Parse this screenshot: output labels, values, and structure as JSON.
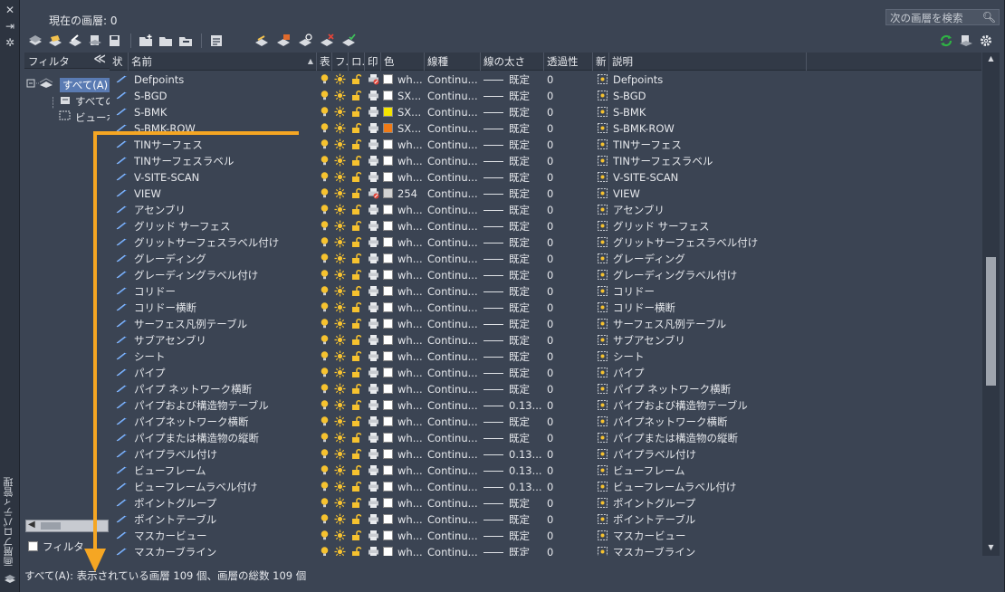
{
  "side_panel": {
    "title": "画層プロパティ管理",
    "buttons": [
      "close-icon",
      "pin-icon",
      "settings-icon"
    ]
  },
  "header": {
    "current_layer_label": "現在の画層: 0",
    "search_placeholder": "次の画層を検索"
  },
  "filter_pane": {
    "header_label": "フィルタ",
    "collapse_glyph": "≪",
    "tree": [
      {
        "label": "すべて(A)",
        "selected": true
      },
      {
        "label": "すべての使用画層",
        "selected": false
      },
      {
        "label": "ビューポート優先",
        "selected": false
      }
    ],
    "invert_filter_label": "フィルタ"
  },
  "columns": {
    "status": "状",
    "name": "名前",
    "on": "表",
    "freeze": "フ.",
    "lock": "ロ.",
    "plot": "印",
    "color": "色",
    "linetype": "線種",
    "lineweight": "線の太さ",
    "transparency": "透過性",
    "new_vp_freeze": "新",
    "description": "説明"
  },
  "rows": [
    {
      "name": "Defpoints",
      "color": "wh...",
      "swatch": "#ffffff",
      "linetype": "Continu...",
      "lineweight": "既定",
      "transparency": "0",
      "description": "Defpoints",
      "plot": "noplot"
    },
    {
      "name": "S-BGD",
      "color": "SX...",
      "swatch": "#ffffff",
      "linetype": "Continu...",
      "lineweight": "既定",
      "transparency": "0",
      "description": "S-BGD",
      "plot": "plot"
    },
    {
      "name": "S-BMK",
      "color": "SX...",
      "swatch": "#f5e400",
      "linetype": "Continu...",
      "lineweight": "既定",
      "transparency": "0",
      "description": "S-BMK",
      "plot": "plot"
    },
    {
      "name": "S-BMK-ROW",
      "color": "SX...",
      "swatch": "#f07a16",
      "linetype": "Continu...",
      "lineweight": "既定",
      "transparency": "0",
      "description": "S-BMK-ROW",
      "plot": "plot"
    },
    {
      "name": "TINサーフェス",
      "color": "wh...",
      "swatch": "#ffffff",
      "linetype": "Continu...",
      "lineweight": "既定",
      "transparency": "0",
      "description": "TINサーフェス",
      "plot": "plot"
    },
    {
      "name": "TINサーフェスラベル",
      "color": "wh...",
      "swatch": "#ffffff",
      "linetype": "Continu...",
      "lineweight": "既定",
      "transparency": "0",
      "description": "TINサーフェスラベル",
      "plot": "plot"
    },
    {
      "name": "V-SITE-SCAN",
      "color": "wh...",
      "swatch": "#ffffff",
      "linetype": "Continu...",
      "lineweight": "既定",
      "transparency": "0",
      "description": "V-SITE-SCAN",
      "plot": "plot"
    },
    {
      "name": "VIEW",
      "color": "254",
      "swatch": "#d2d2d2",
      "linetype": "Continu...",
      "lineweight": "既定",
      "transparency": "0",
      "description": "VIEW",
      "plot": "noplot"
    },
    {
      "name": "アセンブリ",
      "color": "wh...",
      "swatch": "#ffffff",
      "linetype": "Continu...",
      "lineweight": "既定",
      "transparency": "0",
      "description": "アセンブリ",
      "plot": "plot"
    },
    {
      "name": "グリッド サーフェス",
      "color": "wh...",
      "swatch": "#ffffff",
      "linetype": "Continu...",
      "lineweight": "既定",
      "transparency": "0",
      "description": "グリッド サーフェス",
      "plot": "plot"
    },
    {
      "name": "グリットサーフェスラベル付け",
      "color": "wh...",
      "swatch": "#ffffff",
      "linetype": "Continu...",
      "lineweight": "既定",
      "transparency": "0",
      "description": "グリットサーフェスラベル付け",
      "plot": "plot"
    },
    {
      "name": "グレーディング",
      "color": "wh...",
      "swatch": "#ffffff",
      "linetype": "Continu...",
      "lineweight": "既定",
      "transparency": "0",
      "description": "グレーディング",
      "plot": "plot"
    },
    {
      "name": "グレーディングラベル付け",
      "color": "wh...",
      "swatch": "#ffffff",
      "linetype": "Continu...",
      "lineweight": "既定",
      "transparency": "0",
      "description": "グレーディングラベル付け",
      "plot": "plot"
    },
    {
      "name": "コリドー",
      "color": "wh...",
      "swatch": "#ffffff",
      "linetype": "Continu...",
      "lineweight": "既定",
      "transparency": "0",
      "description": "コリドー",
      "plot": "plot"
    },
    {
      "name": "コリドー横断",
      "color": "wh...",
      "swatch": "#ffffff",
      "linetype": "Continu...",
      "lineweight": "既定",
      "transparency": "0",
      "description": "コリドー横断",
      "plot": "plot"
    },
    {
      "name": "サーフェス凡例テーブル",
      "color": "wh...",
      "swatch": "#ffffff",
      "linetype": "Continu...",
      "lineweight": "既定",
      "transparency": "0",
      "description": "サーフェス凡例テーブル",
      "plot": "plot"
    },
    {
      "name": "サブアセンブリ",
      "color": "wh...",
      "swatch": "#ffffff",
      "linetype": "Continu...",
      "lineweight": "既定",
      "transparency": "0",
      "description": "サブアセンブリ",
      "plot": "plot"
    },
    {
      "name": "シート",
      "color": "wh...",
      "swatch": "#ffffff",
      "linetype": "Continu...",
      "lineweight": "既定",
      "transparency": "0",
      "description": "シート",
      "plot": "plot"
    },
    {
      "name": "パイプ",
      "color": "wh...",
      "swatch": "#ffffff",
      "linetype": "Continu...",
      "lineweight": "既定",
      "transparency": "0",
      "description": "パイプ",
      "plot": "plot"
    },
    {
      "name": "パイプ ネットワーク横断",
      "color": "wh...",
      "swatch": "#ffffff",
      "linetype": "Continu...",
      "lineweight": "既定",
      "transparency": "0",
      "description": "パイプ ネットワーク横断",
      "plot": "plot"
    },
    {
      "name": "パイプおよび構造物テーブル",
      "color": "wh...",
      "swatch": "#ffffff",
      "linetype": "Continu...",
      "lineweight": "0.13...",
      "transparency": "0",
      "description": "パイプおよび構造物テーブル",
      "plot": "plot"
    },
    {
      "name": "パイプネットワーク横断",
      "color": "wh...",
      "swatch": "#ffffff",
      "linetype": "Continu...",
      "lineweight": "既定",
      "transparency": "0",
      "description": "パイプネットワーク横断",
      "plot": "plot"
    },
    {
      "name": "パイプまたは構造物の縦断",
      "color": "wh...",
      "swatch": "#ffffff",
      "linetype": "Continu...",
      "lineweight": "既定",
      "transparency": "0",
      "description": "パイプまたは構造物の縦断",
      "plot": "plot"
    },
    {
      "name": "パイプラベル付け",
      "color": "wh...",
      "swatch": "#ffffff",
      "linetype": "Continu...",
      "lineweight": "0.13...",
      "transparency": "0",
      "description": "パイプラベル付け",
      "plot": "plot"
    },
    {
      "name": "ビューフレーム",
      "color": "wh...",
      "swatch": "#ffffff",
      "linetype": "Continu...",
      "lineweight": "0.13...",
      "transparency": "0",
      "description": "ビューフレーム",
      "plot": "plot"
    },
    {
      "name": "ビューフレームラベル付け",
      "color": "wh...",
      "swatch": "#ffffff",
      "linetype": "Continu...",
      "lineweight": "0.13...",
      "transparency": "0",
      "description": "ビューフレームラベル付け",
      "plot": "plot"
    },
    {
      "name": "ポイントグループ",
      "color": "wh...",
      "swatch": "#ffffff",
      "linetype": "Continu...",
      "lineweight": "既定",
      "transparency": "0",
      "description": "ポイントグループ",
      "plot": "plot"
    },
    {
      "name": "ポイントテーブル",
      "color": "wh...",
      "swatch": "#ffffff",
      "linetype": "Continu...",
      "lineweight": "既定",
      "transparency": "0",
      "description": "ポイントテーブル",
      "plot": "plot"
    },
    {
      "name": "マスカービュー",
      "color": "wh...",
      "swatch": "#ffffff",
      "linetype": "Continu...",
      "lineweight": "既定",
      "transparency": "0",
      "description": "マスカービュー",
      "plot": "plot"
    },
    {
      "name": "マスカーブライン",
      "color": "wh...",
      "swatch": "#ffffff",
      "linetype": "Continu...",
      "lineweight": "既定",
      "transparency": "0",
      "description": "マスカーブライン",
      "plot": "plot"
    }
  ],
  "status_bar": "すべて(A): 表示されている画層 109 個、画層の総数 109 個",
  "colors": {
    "panel_bg": "#3b4453",
    "header_bg": "#323a47",
    "selection": "#5a7bb3",
    "annotation_arrow": "#f5a623",
    "bulb": "#f6c22f",
    "refresh": "#2fb344"
  }
}
